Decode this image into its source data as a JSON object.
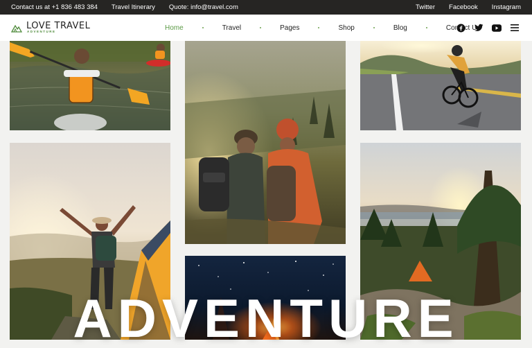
{
  "topbar": {
    "contact": "Contact us at +1 836 483 384",
    "itinerary": "Travel Itinerary",
    "quote": "Quote: info@travel.com",
    "social": [
      "Twitter",
      "Facebook",
      "Instagram"
    ]
  },
  "brand": {
    "name": "LOVE TRAVEL",
    "tagline": "ADVENTURE",
    "accent": "#5b9a45"
  },
  "nav": {
    "items": [
      "Home",
      "Travel",
      "Pages",
      "Shop",
      "Blog",
      "Contact Us"
    ],
    "active": "Home",
    "icons": [
      "facebook-icon",
      "twitter-icon",
      "youtube-icon",
      "menu-icon"
    ]
  },
  "gallery": {
    "photos": [
      "kayaker-lake",
      "hikers-forest",
      "cyclist-road",
      "woman-mountain-tent",
      "campfire-night",
      "sunset-lake-camp"
    ]
  },
  "hero": {
    "word": "ADVENTURE"
  }
}
